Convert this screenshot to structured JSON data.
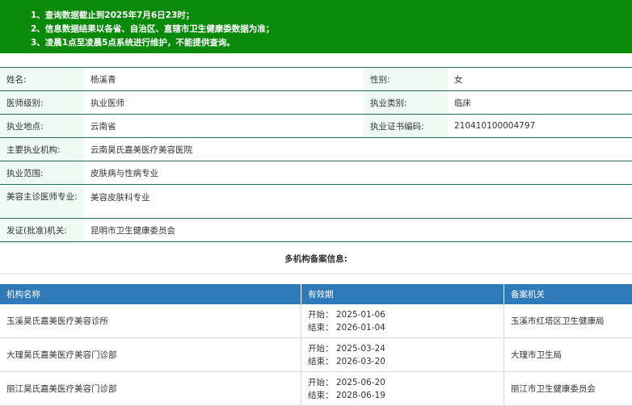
{
  "notice": {
    "lines": [
      "1、查询数据截止到2025年7月6日23时；",
      "2、信息数据结果以各省、自治区、直辖市卫生健康委数据为准；",
      "3、凌晨1点至凌晨5点系统进行维护，不能提供查询。"
    ]
  },
  "doctor": {
    "name_label": "姓名:",
    "name": "杨溪青",
    "gender_label": "性别:",
    "gender": "女",
    "level_label": "医师级别:",
    "level": "执业医师",
    "category_label": "执业类别:",
    "category": "临床",
    "location_label": "执业地点:",
    "location": "云南省",
    "cert_label": "执业证书编码:",
    "cert": "210410100004797",
    "org_label": "主要执业机构:",
    "org": "云南昊氏嘉美医疗美容医院",
    "scope_label": "执业范围:",
    "scope": "皮肤病与性病专业",
    "cosmetic_label": "美容主诊医师专业:",
    "cosmetic": "美容皮肤科专业",
    "issuer_label": "发证(批准)机关:",
    "issuer": "昆明市卫生健康委员会"
  },
  "multi_title": "多机构备案信息:",
  "orgs": {
    "headers": [
      "机构名称",
      "有效期",
      "备案机关"
    ],
    "rows": [
      {
        "name": "玉溪昊氏嘉美医疗美容诊所",
        "start": "开始：  2025-01-06",
        "end": "结束：  2026-01-04",
        "authority": "玉溪市红塔区卫生健康局"
      },
      {
        "name": "大理昊氏嘉美医疗美容门诊部",
        "start": "开始：  2025-03-24",
        "end": "结束：  2026-03-20",
        "authority": "大理市卫生局"
      },
      {
        "name": "丽江昊氏嘉美医疗美容门诊部",
        "start": "开始：  2025-06-20",
        "end": "结束：  2028-06-19",
        "authority": "丽江市卫生健康委员会"
      }
    ]
  }
}
